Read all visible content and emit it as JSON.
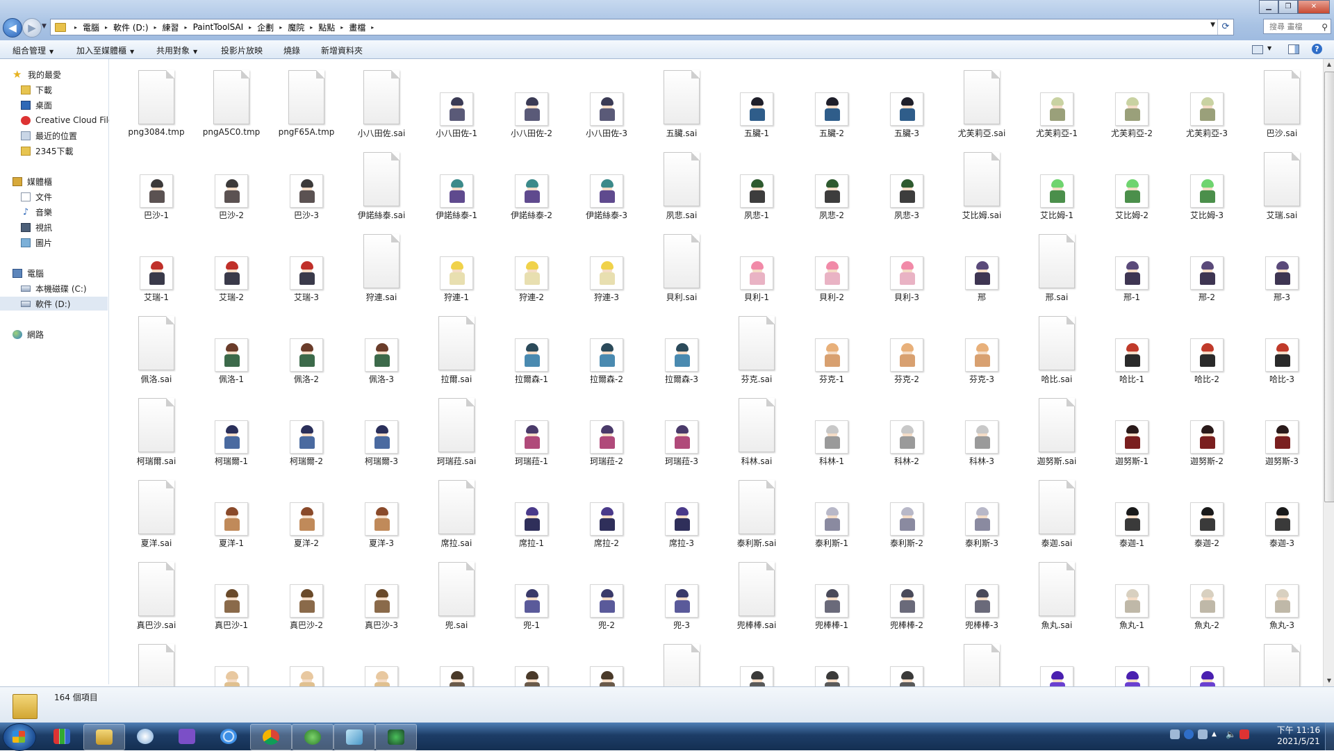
{
  "address": {
    "breadcrumbs": [
      "電腦",
      "軟件 (D:)",
      "練習",
      "PaintToolSAI",
      "企劃",
      "魔院",
      "點點",
      "畫檔"
    ]
  },
  "search": {
    "placeholder": "搜尋 畫檔"
  },
  "toolbar": {
    "organize": "組合管理",
    "add_to_library": "加入至媒體櫃",
    "share": "共用對象",
    "slideshow": "投影片放映",
    "burn": "燒錄",
    "new_folder": "新增資料夾"
  },
  "sidebar": {
    "favorites": {
      "label": "我的最愛",
      "items": [
        "下載",
        "桌面",
        "Creative Cloud File",
        "最近的位置",
        "2345下載"
      ]
    },
    "libraries": {
      "label": "媒體櫃",
      "items": [
        "文件",
        "音樂",
        "視訊",
        "圖片"
      ]
    },
    "computer": {
      "label": "電腦",
      "items": [
        "本機磁碟 (C:)",
        "軟件 (D:)"
      ]
    },
    "network": {
      "label": "網路"
    }
  },
  "files": [
    {
      "name": "png3084.tmp",
      "kind": "doc"
    },
    {
      "name": "pngA5C0.tmp",
      "kind": "doc"
    },
    {
      "name": "pngF65A.tmp",
      "kind": "doc"
    },
    {
      "name": "小八田佐.sai",
      "kind": "doc"
    },
    {
      "name": "小八田佐-1",
      "kind": "img",
      "hair": "#3b3b55",
      "body": "#5a5a78"
    },
    {
      "name": "小八田佐-2",
      "kind": "img",
      "hair": "#3b3b55",
      "body": "#5a5a78"
    },
    {
      "name": "小八田佐-3",
      "kind": "img",
      "hair": "#3b3b55",
      "body": "#5a5a78"
    },
    {
      "name": "五臟.sai",
      "kind": "doc"
    },
    {
      "name": "五臟-1",
      "kind": "img",
      "hair": "#1f1f2a",
      "body": "#2f5d8a"
    },
    {
      "name": "五臟-2",
      "kind": "img",
      "hair": "#1f1f2a",
      "body": "#2f5d8a"
    },
    {
      "name": "五臟-3",
      "kind": "img",
      "hair": "#1f1f2a",
      "body": "#2f5d8a"
    },
    {
      "name": "尤芙莉亞.sai",
      "kind": "doc"
    },
    {
      "name": "尤芙莉亞-1",
      "kind": "img",
      "hair": "#c9d2a2",
      "body": "#9aa07a"
    },
    {
      "name": "尤芙莉亞-2",
      "kind": "img",
      "hair": "#c9d2a2",
      "body": "#9aa07a"
    },
    {
      "name": "尤芙莉亞-3",
      "kind": "img",
      "hair": "#c9d2a2",
      "body": "#9aa07a"
    },
    {
      "name": "巴沙.sai",
      "kind": "doc"
    },
    {
      "name": "巴沙-1",
      "kind": "img",
      "hair": "#3c3a3a",
      "body": "#5b5252"
    },
    {
      "name": "巴沙-2",
      "kind": "img",
      "hair": "#3c3a3a",
      "body": "#5b5252"
    },
    {
      "name": "巴沙-3",
      "kind": "img",
      "hair": "#3c3a3a",
      "body": "#5b5252"
    },
    {
      "name": "伊諾絲泰.sai",
      "kind": "doc"
    },
    {
      "name": "伊諾絲泰-1",
      "kind": "img",
      "hair": "#3c8a8a",
      "body": "#5f4a8e"
    },
    {
      "name": "伊諾絲泰-2",
      "kind": "img",
      "hair": "#3c8a8a",
      "body": "#5f4a8e"
    },
    {
      "name": "伊諾絲泰-3",
      "kind": "img",
      "hair": "#3c8a8a",
      "body": "#5f4a8e"
    },
    {
      "name": "夙悲.sai",
      "kind": "doc"
    },
    {
      "name": "夙悲-1",
      "kind": "img",
      "hair": "#2f5a2f",
      "body": "#3d3d3d"
    },
    {
      "name": "夙悲-2",
      "kind": "img",
      "hair": "#2f5a2f",
      "body": "#3d3d3d"
    },
    {
      "name": "夙悲-3",
      "kind": "img",
      "hair": "#2f5a2f",
      "body": "#3d3d3d"
    },
    {
      "name": "艾比姆.sai",
      "kind": "doc"
    },
    {
      "name": "艾比姆-1",
      "kind": "img",
      "hair": "#6fd46f",
      "body": "#4b8f4b"
    },
    {
      "name": "艾比姆-2",
      "kind": "img",
      "hair": "#6fd46f",
      "body": "#4b8f4b"
    },
    {
      "name": "艾比姆-3",
      "kind": "img",
      "hair": "#6fd46f",
      "body": "#4b8f4b"
    },
    {
      "name": "艾瑞.sai",
      "kind": "doc"
    },
    {
      "name": "艾瑞-1",
      "kind": "img",
      "hair": "#c0302a",
      "body": "#3a3a4a"
    },
    {
      "name": "艾瑞-2",
      "kind": "img",
      "hair": "#c0302a",
      "body": "#3a3a4a"
    },
    {
      "name": "艾瑞-3",
      "kind": "img",
      "hair": "#c0302a",
      "body": "#3a3a4a"
    },
    {
      "name": "狩連.sai",
      "kind": "doc"
    },
    {
      "name": "狩連-1",
      "kind": "img",
      "hair": "#f0d24a",
      "body": "#e8dfb0"
    },
    {
      "name": "狩連-2",
      "kind": "img",
      "hair": "#f0d24a",
      "body": "#e8dfb0"
    },
    {
      "name": "狩連-3",
      "kind": "img",
      "hair": "#f0d24a",
      "body": "#e8dfb0"
    },
    {
      "name": "貝利.sai",
      "kind": "doc"
    },
    {
      "name": "貝利-1",
      "kind": "img",
      "hair": "#f18aa8",
      "body": "#e9b3c4"
    },
    {
      "name": "貝利-2",
      "kind": "img",
      "hair": "#f18aa8",
      "body": "#e9b3c4"
    },
    {
      "name": "貝利-3",
      "kind": "img",
      "hair": "#f18aa8",
      "body": "#e9b3c4"
    },
    {
      "name": "邢",
      "kind": "img",
      "hair": "#5a4a7a",
      "body": "#3e3552"
    },
    {
      "name": "邢.sai",
      "kind": "doc"
    },
    {
      "name": "邢-1",
      "kind": "img",
      "hair": "#5a4a7a",
      "body": "#3e3552"
    },
    {
      "name": "邢-2",
      "kind": "img",
      "hair": "#5a4a7a",
      "body": "#3e3552"
    },
    {
      "name": "邢-3",
      "kind": "img",
      "hair": "#5a4a7a",
      "body": "#3e3552"
    },
    {
      "name": "佩洛.sai",
      "kind": "doc"
    },
    {
      "name": "佩洛-1",
      "kind": "img",
      "hair": "#6a3c2a",
      "body": "#3c6a4a"
    },
    {
      "name": "佩洛-2",
      "kind": "img",
      "hair": "#6a3c2a",
      "body": "#3c6a4a"
    },
    {
      "name": "佩洛-3",
      "kind": "img",
      "hair": "#6a3c2a",
      "body": "#3c6a4a"
    },
    {
      "name": "拉爾.sai",
      "kind": "doc"
    },
    {
      "name": "拉爾森-1",
      "kind": "img",
      "hair": "#2b4a5a",
      "body": "#4a8ab0"
    },
    {
      "name": "拉爾森-2",
      "kind": "img",
      "hair": "#2b4a5a",
      "body": "#4a8ab0"
    },
    {
      "name": "拉爾森-3",
      "kind": "img",
      "hair": "#2b4a5a",
      "body": "#4a8ab0"
    },
    {
      "name": "芬克.sai",
      "kind": "doc"
    },
    {
      "name": "芬克-1",
      "kind": "img",
      "hair": "#e8b07a",
      "body": "#d8a070"
    },
    {
      "name": "芬克-2",
      "kind": "img",
      "hair": "#e8b07a",
      "body": "#d8a070"
    },
    {
      "name": "芬克-3",
      "kind": "img",
      "hair": "#e8b07a",
      "body": "#d8a070"
    },
    {
      "name": "哈比.sai",
      "kind": "doc"
    },
    {
      "name": "哈比-1",
      "kind": "img",
      "hair": "#c03a2a",
      "body": "#2a2a2a"
    },
    {
      "name": "哈比-2",
      "kind": "img",
      "hair": "#c03a2a",
      "body": "#2a2a2a"
    },
    {
      "name": "哈比-3",
      "kind": "img",
      "hair": "#c03a2a",
      "body": "#2a2a2a"
    },
    {
      "name": "柯瑞爾.sai",
      "kind": "doc"
    },
    {
      "name": "柯瑞爾-1",
      "kind": "img",
      "hair": "#2a2f5a",
      "body": "#4a6aa0"
    },
    {
      "name": "柯瑞爾-2",
      "kind": "img",
      "hair": "#2a2f5a",
      "body": "#4a6aa0"
    },
    {
      "name": "柯瑞爾-3",
      "kind": "img",
      "hair": "#2a2f5a",
      "body": "#4a6aa0"
    },
    {
      "name": "珂瑞菈.sai",
      "kind": "doc"
    },
    {
      "name": "珂瑞菈-1",
      "kind": "img",
      "hair": "#4a3a6a",
      "body": "#b04a7a"
    },
    {
      "name": "珂瑞菈-2",
      "kind": "img",
      "hair": "#4a3a6a",
      "body": "#b04a7a"
    },
    {
      "name": "珂瑞菈-3",
      "kind": "img",
      "hair": "#4a3a6a",
      "body": "#b04a7a"
    },
    {
      "name": "科林.sai",
      "kind": "doc"
    },
    {
      "name": "科林-1",
      "kind": "img",
      "hair": "#c8c8c8",
      "body": "#9a9a9a"
    },
    {
      "name": "科林-2",
      "kind": "img",
      "hair": "#c8c8c8",
      "body": "#9a9a9a"
    },
    {
      "name": "科林-3",
      "kind": "img",
      "hair": "#c8c8c8",
      "body": "#9a9a9a"
    },
    {
      "name": "迦努斯.sai",
      "kind": "doc"
    },
    {
      "name": "迦努斯-1",
      "kind": "img",
      "hair": "#2a1a1a",
      "body": "#7a1f1f"
    },
    {
      "name": "迦努斯-2",
      "kind": "img",
      "hair": "#2a1a1a",
      "body": "#7a1f1f"
    },
    {
      "name": "迦努斯-3",
      "kind": "img",
      "hair": "#2a1a1a",
      "body": "#7a1f1f"
    },
    {
      "name": "夏洋.sai",
      "kind": "doc"
    },
    {
      "name": "夏洋-1",
      "kind": "img",
      "hair": "#8a4a2a",
      "body": "#c08a5a"
    },
    {
      "name": "夏洋-2",
      "kind": "img",
      "hair": "#8a4a2a",
      "body": "#c08a5a"
    },
    {
      "name": "夏洋-3",
      "kind": "img",
      "hair": "#8a4a2a",
      "body": "#c08a5a"
    },
    {
      "name": "席拉.sai",
      "kind": "doc"
    },
    {
      "name": "席拉-1",
      "kind": "img",
      "hair": "#4a3a8a",
      "body": "#2f2f5a"
    },
    {
      "name": "席拉-2",
      "kind": "img",
      "hair": "#4a3a8a",
      "body": "#2f2f5a"
    },
    {
      "name": "席拉-3",
      "kind": "img",
      "hair": "#4a3a8a",
      "body": "#2f2f5a"
    },
    {
      "name": "泰利斯.sai",
      "kind": "doc"
    },
    {
      "name": "泰利斯-1",
      "kind": "img",
      "hair": "#b8b8c8",
      "body": "#8a8aa0"
    },
    {
      "name": "泰利斯-2",
      "kind": "img",
      "hair": "#b8b8c8",
      "body": "#8a8aa0"
    },
    {
      "name": "泰利斯-3",
      "kind": "img",
      "hair": "#b8b8c8",
      "body": "#8a8aa0"
    },
    {
      "name": "泰迦.sai",
      "kind": "doc"
    },
    {
      "name": "泰迦-1",
      "kind": "img",
      "hair": "#1a1a1a",
      "body": "#3a3a3a"
    },
    {
      "name": "泰迦-2",
      "kind": "img",
      "hair": "#1a1a1a",
      "body": "#3a3a3a"
    },
    {
      "name": "泰迦-3",
      "kind": "img",
      "hair": "#1a1a1a",
      "body": "#3a3a3a"
    },
    {
      "name": "真巴沙.sai",
      "kind": "doc"
    },
    {
      "name": "真巴沙-1",
      "kind": "img",
      "hair": "#6a4a2a",
      "body": "#8a6a4a"
    },
    {
      "name": "真巴沙-2",
      "kind": "img",
      "hair": "#6a4a2a",
      "body": "#8a6a4a"
    },
    {
      "name": "真巴沙-3",
      "kind": "img",
      "hair": "#6a4a2a",
      "body": "#8a6a4a"
    },
    {
      "name": "兜.sai",
      "kind": "doc"
    },
    {
      "name": "兜-1",
      "kind": "img",
      "hair": "#3a3a6a",
      "body": "#5a5a9a"
    },
    {
      "name": "兜-2",
      "kind": "img",
      "hair": "#3a3a6a",
      "body": "#5a5a9a"
    },
    {
      "name": "兜-3",
      "kind": "img",
      "hair": "#3a3a6a",
      "body": "#5a5a9a"
    },
    {
      "name": "兜棒棒.sai",
      "kind": "doc"
    },
    {
      "name": "兜棒棒-1",
      "kind": "img",
      "hair": "#4a4a5a",
      "body": "#6a6a7a"
    },
    {
      "name": "兜棒棒-2",
      "kind": "img",
      "hair": "#4a4a5a",
      "body": "#6a6a7a"
    },
    {
      "name": "兜棒棒-3",
      "kind": "img",
      "hair": "#4a4a5a",
      "body": "#6a6a7a"
    },
    {
      "name": "魚丸.sai",
      "kind": "doc"
    },
    {
      "name": "魚丸-1",
      "kind": "img",
      "hair": "#d8d0c0",
      "body": "#bfb8a8"
    },
    {
      "name": "魚丸-2",
      "kind": "img",
      "hair": "#d8d0c0",
      "body": "#bfb8a8"
    },
    {
      "name": "魚丸-3",
      "kind": "img",
      "hair": "#d8d0c0",
      "body": "#bfb8a8"
    },
    {
      "name": "",
      "kind": "doc"
    },
    {
      "name": "",
      "kind": "img",
      "hair": "#e8c8a0",
      "body": "#e0c090"
    },
    {
      "name": "",
      "kind": "img",
      "hair": "#e8c8a0",
      "body": "#e0c090"
    },
    {
      "name": "",
      "kind": "img",
      "hair": "#e8c8a0",
      "body": "#e0c090"
    },
    {
      "name": "",
      "kind": "img",
      "hair": "#4a3a2a",
      "body": "#6a5a4a"
    },
    {
      "name": "",
      "kind": "img",
      "hair": "#4a3a2a",
      "body": "#6a5a4a"
    },
    {
      "name": "",
      "kind": "img",
      "hair": "#4a3a2a",
      "body": "#6a5a4a"
    },
    {
      "name": "",
      "kind": "doc"
    },
    {
      "name": "",
      "kind": "img",
      "hair": "#3a3a3a",
      "body": "#5a5a5a"
    },
    {
      "name": "",
      "kind": "img",
      "hair": "#3a3a3a",
      "body": "#5a5a5a"
    },
    {
      "name": "",
      "kind": "img",
      "hair": "#3a3a3a",
      "body": "#5a5a5a"
    },
    {
      "name": "",
      "kind": "doc"
    },
    {
      "name": "",
      "kind": "img",
      "hair": "#4a20b0",
      "body": "#6a40d0"
    },
    {
      "name": "",
      "kind": "img",
      "hair": "#4a20b0",
      "body": "#6a40d0"
    },
    {
      "name": "",
      "kind": "img",
      "hair": "#4a20b0",
      "body": "#6a40d0"
    },
    {
      "name": "",
      "kind": "doc"
    }
  ],
  "status": {
    "item_count": "164 個項目"
  },
  "clock": {
    "time": "下午 11:16",
    "date": "2021/5/21"
  }
}
